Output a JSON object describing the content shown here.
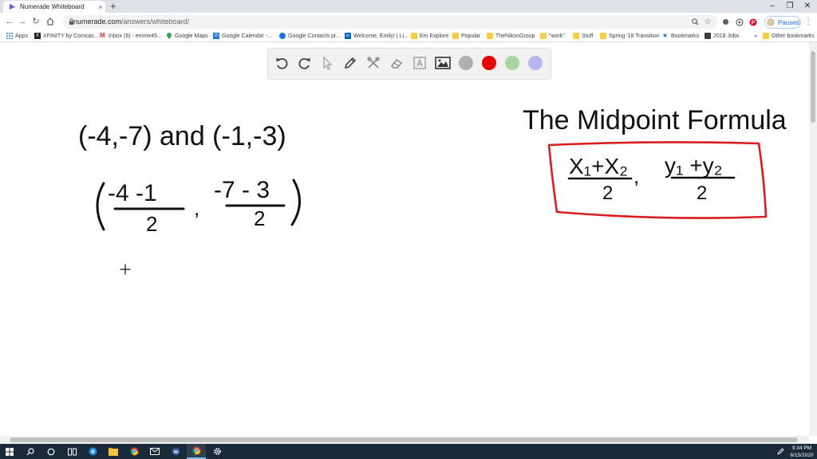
{
  "browser": {
    "tab_title": "Numerade Whiteboard",
    "tab_close": "×",
    "new_tab": "+",
    "url_domain": "numerade.com",
    "url_path": "/answers/whiteboard/",
    "profile_status": "Paused",
    "window_controls": {
      "minimize": "–",
      "maximize": "❐",
      "close": "✕"
    }
  },
  "bookmarks": [
    {
      "label": "Apps",
      "icon": "apps-grid-icon"
    },
    {
      "label": "XFINITY by Comcas...",
      "icon": "xfinity-icon"
    },
    {
      "label": "Inbox (6) - emme45...",
      "icon": "gmail-icon"
    },
    {
      "label": "Google Maps",
      "icon": "maps-pin-icon"
    },
    {
      "label": "Google Calendar -...",
      "icon": "calendar-icon"
    },
    {
      "label": "Google Contacts pr...",
      "icon": "contacts-icon"
    },
    {
      "label": "Welcome, Emily! | Li...",
      "icon": "linkedin-icon"
    },
    {
      "label": "Em Explore",
      "icon": "folder-icon"
    },
    {
      "label": "Popular",
      "icon": "folder-icon"
    },
    {
      "label": "TheNikooGroup",
      "icon": "folder-icon"
    },
    {
      "label": "\"work\"",
      "icon": "folder-icon"
    },
    {
      "label": "Stuff",
      "icon": "folder-icon"
    },
    {
      "label": "Spring '18 Transition",
      "icon": "folder-icon"
    },
    {
      "label": "Bookmarks",
      "icon": "star-icon"
    },
    {
      "label": "2018 Jobs",
      "icon": "jobs-icon"
    },
    {
      "label": "Other bookmarks",
      "icon": "folder-icon"
    }
  ],
  "colors": {
    "pen_red": "#e60000",
    "pen_green": "#a8d5a0",
    "pen_blue": "#b7b7ef",
    "pen_grey": "#b0b0b0",
    "ink": "#111111",
    "box_red": "#d81e1e"
  },
  "whiteboard": {
    "left_line1": "(-4,-7) and (-1,-3)",
    "num_left": "-4 -1",
    "num_right": "-7 - 3",
    "den_left": "2",
    "den_right": "2",
    "comma": ",",
    "title": "The Midpoint Formula",
    "formula_x_num": "X₁+X₂",
    "formula_y_num": "y₁ +y₂",
    "formula_den_x": "2",
    "formula_den_y": "2",
    "formula_comma": ","
  },
  "taskbar": {
    "time": "9:34 PM",
    "date": "6/15/2020"
  }
}
